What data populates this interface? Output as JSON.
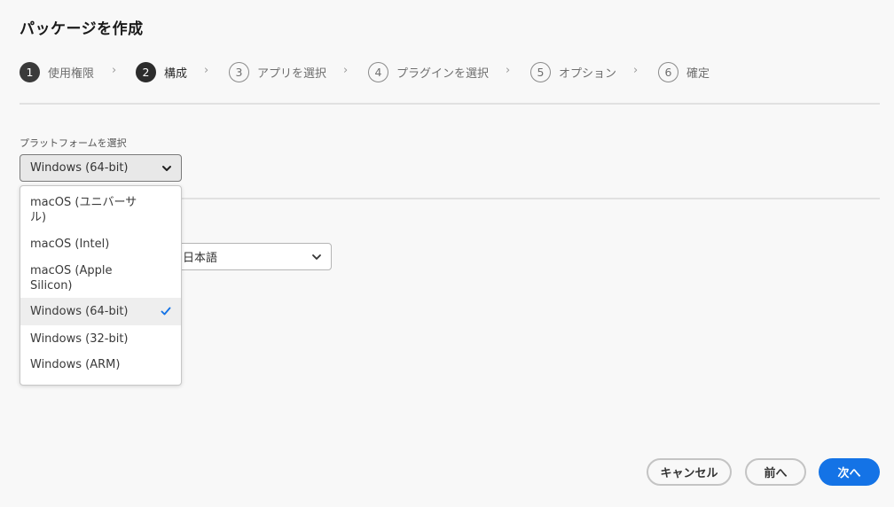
{
  "page": {
    "title": "パッケージを作成"
  },
  "stepper": {
    "steps": [
      {
        "number": "1",
        "label": "使用権限",
        "state": "done"
      },
      {
        "number": "2",
        "label": "構成",
        "state": "active"
      },
      {
        "number": "3",
        "label": "アプリを選択",
        "state": "pending"
      },
      {
        "number": "4",
        "label": "プラグインを選択",
        "state": "pending"
      },
      {
        "number": "5",
        "label": "オプション",
        "state": "pending"
      },
      {
        "number": "6",
        "label": "確定",
        "state": "pending"
      }
    ],
    "separator": "›"
  },
  "platform": {
    "label": "プラットフォームを選択",
    "selected": "Windows (64-bit)",
    "options": [
      {
        "label": "macOS (ユニバーサル)",
        "lines": [
          "macOS (ユニバーサ",
          "ル)"
        ]
      },
      {
        "label": "macOS (Intel)",
        "lines": [
          "macOS (Intel)"
        ]
      },
      {
        "label": "macOS (Apple Silicon)",
        "lines": [
          "macOS (Apple",
          "Silicon)"
        ]
      },
      {
        "label": "Windows (64-bit)",
        "lines": [
          "Windows (64-bit)"
        ],
        "selected": true
      },
      {
        "label": "Windows (32-bit)",
        "lines": [
          "Windows (32-bit)"
        ]
      },
      {
        "label": "Windows (ARM)",
        "lines": [
          "Windows (ARM)"
        ]
      }
    ]
  },
  "language": {
    "selected": "日本語"
  },
  "footer": {
    "cancel_label": "キャンセル",
    "back_label": "前へ",
    "next_label": "次へ"
  },
  "colors": {
    "accent": "#1473e6",
    "check": "#1473e6",
    "step_active": "#2c2c2c"
  },
  "icons": {
    "dropdown": "chevron-down-icon",
    "selected": "checkmark-icon",
    "step_separator": "chevron-right-icon"
  }
}
